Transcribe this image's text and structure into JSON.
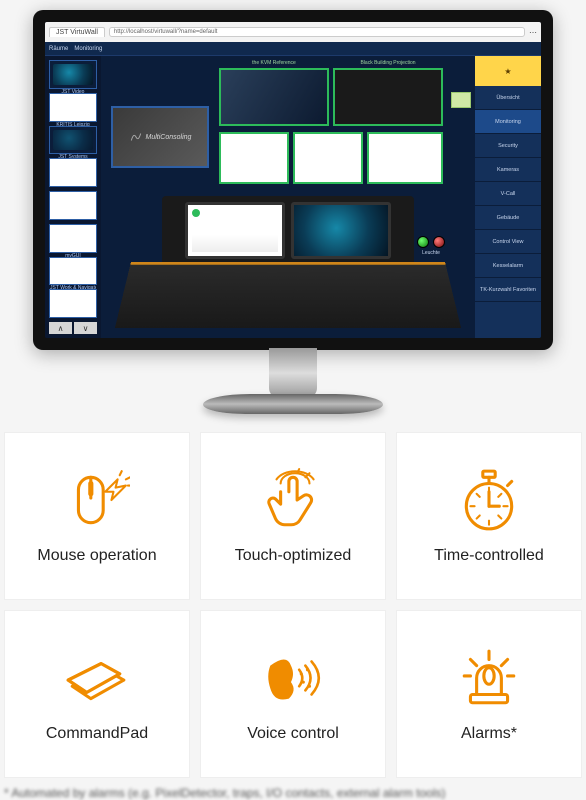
{
  "browser": {
    "tab": "JST VirtuWall",
    "url": "http://localhost/virtuwall/?name=default"
  },
  "app": {
    "menu": [
      "Räume",
      "Monitoring"
    ]
  },
  "thumbs": [
    {
      "label": "JST Video",
      "dark": true
    },
    {
      "label": "KRITIS Leipzig",
      "dark": false
    },
    {
      "label": "JST Systems",
      "dark": true
    },
    {
      "label": "",
      "dark": false
    },
    {
      "label": "",
      "dark": false
    },
    {
      "label": "myGUI",
      "dark": false
    },
    {
      "label": "JST Work & Navigate",
      "dark": false
    },
    {
      "label": "",
      "dark": false
    }
  ],
  "canvas": {
    "consoling_text": "MultiConsoling",
    "tile1": "the KVM Reference",
    "tile2": "Black Building Projection",
    "tile3": "",
    "tile4": "",
    "tile5": "",
    "indicator": "Leuchte"
  },
  "right_panel": [
    "Übersicht",
    "Monitoring",
    "Security",
    "Kameras",
    "V-Call",
    "Gebäude",
    "Control View",
    "Kesselalarm",
    "TK-Kurzwahl Favoriten"
  ],
  "features": [
    {
      "icon": "mouse",
      "label": "Mouse operation"
    },
    {
      "icon": "touch",
      "label": "Touch-optimized"
    },
    {
      "icon": "stopwatch",
      "label": "Time-controlled"
    },
    {
      "icon": "commandpad",
      "label": "CommandPad"
    },
    {
      "icon": "voice",
      "label": "Voice control"
    },
    {
      "icon": "alarm",
      "label": "Alarms*"
    }
  ],
  "footnote": "* Automated by alarms (e.g. PixelDetector, traps, I/O contacts, external alarm tools)"
}
